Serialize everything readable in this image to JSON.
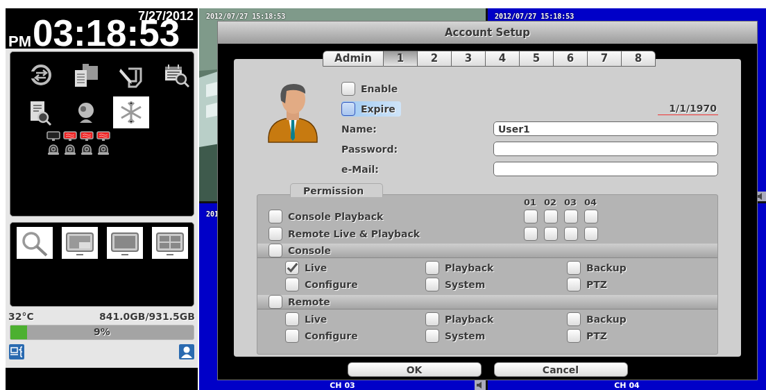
{
  "clock": {
    "date": "7/27/2012",
    "meridiem": "PM",
    "time": "03:18:53"
  },
  "tool_icons": [
    {
      "kind": "replay",
      "selected": false
    },
    {
      "kind": "files",
      "selected": false
    },
    {
      "kind": "hand",
      "selected": false
    },
    {
      "kind": "calendar-search",
      "selected": false
    },
    {
      "kind": "log-search",
      "selected": false
    },
    {
      "kind": "webcam",
      "selected": false
    },
    {
      "kind": "snowflake",
      "selected": true
    }
  ],
  "video_status": [
    {
      "alert": false
    },
    {
      "alert": true
    },
    {
      "alert": true
    },
    {
      "alert": true
    }
  ],
  "alarm_inputs": [
    {
      "triggered": false
    },
    {
      "triggered": false
    },
    {
      "triggered": false
    },
    {
      "triggered": false
    }
  ],
  "view_buttons": [
    {
      "kind": "search"
    },
    {
      "kind": "pip"
    },
    {
      "kind": "single"
    },
    {
      "kind": "quad"
    }
  ],
  "status": {
    "temperature": "32°C",
    "disk": "841.0GB/931.5GB",
    "disk_usage": {
      "level": 0.09,
      "reading": "9%"
    }
  },
  "cameras": [
    {
      "kind": "picture",
      "timestamp": "2012/07/27 15:18:53",
      "audio": false
    },
    {
      "kind": "blank",
      "timestamp": "2012/07/27 15:18:53",
      "audio": true
    },
    {
      "kind": "blank",
      "timestamp": "201",
      "label": "CH 03",
      "audio": true
    },
    {
      "kind": "blank",
      "label": "CH 04",
      "audio": false
    }
  ],
  "dialog": {
    "title": "Account Setup",
    "tabs": [
      {
        "label": "Admin",
        "selected": false
      },
      {
        "label": "1",
        "selected": true
      },
      {
        "label": "2",
        "selected": false
      },
      {
        "label": "3",
        "selected": false
      },
      {
        "label": "4",
        "selected": false
      },
      {
        "label": "5",
        "selected": false
      },
      {
        "label": "6",
        "selected": false
      },
      {
        "label": "7",
        "selected": false
      },
      {
        "label": "8",
        "selected": false
      }
    ],
    "enable": {
      "label": "Enable",
      "checked": false
    },
    "expire": {
      "label": "Expire",
      "checked": false,
      "focused": true,
      "date": "1/1/1970"
    },
    "fields": [
      {
        "label": "Name:",
        "value": "User1"
      },
      {
        "label": "Password:"
      },
      {
        "label": "e-Mail:"
      }
    ],
    "permission": {
      "title": "Permission",
      "channels": [
        "01",
        "02",
        "03",
        "04"
      ],
      "channel_rights": [
        {
          "label": "Console Playback",
          "checked": false,
          "channels": [
            false,
            false,
            false,
            false
          ]
        },
        {
          "label": "Remote Live & Playback",
          "checked": false,
          "channels": [
            false,
            false,
            false,
            false
          ]
        }
      ],
      "sections": [
        {
          "label": "Console",
          "checked": false,
          "items": [
            {
              "label": "Live",
              "checked": true
            },
            {
              "label": "Playback",
              "checked": false
            },
            {
              "label": "Backup",
              "checked": false
            },
            {
              "label": "Configure",
              "checked": false
            },
            {
              "label": "System",
              "checked": false
            },
            {
              "label": "PTZ",
              "checked": false
            }
          ]
        },
        {
          "label": "Remote",
          "checked": false,
          "items": [
            {
              "label": "Live",
              "checked": false
            },
            {
              "label": "Playback",
              "checked": false
            },
            {
              "label": "Backup",
              "checked": false
            },
            {
              "label": "Configure",
              "checked": false
            },
            {
              "label": "System",
              "checked": false
            },
            {
              "label": "PTZ",
              "checked": false
            }
          ]
        }
      ]
    },
    "buttons": [
      "OK",
      "Cancel"
    ]
  }
}
